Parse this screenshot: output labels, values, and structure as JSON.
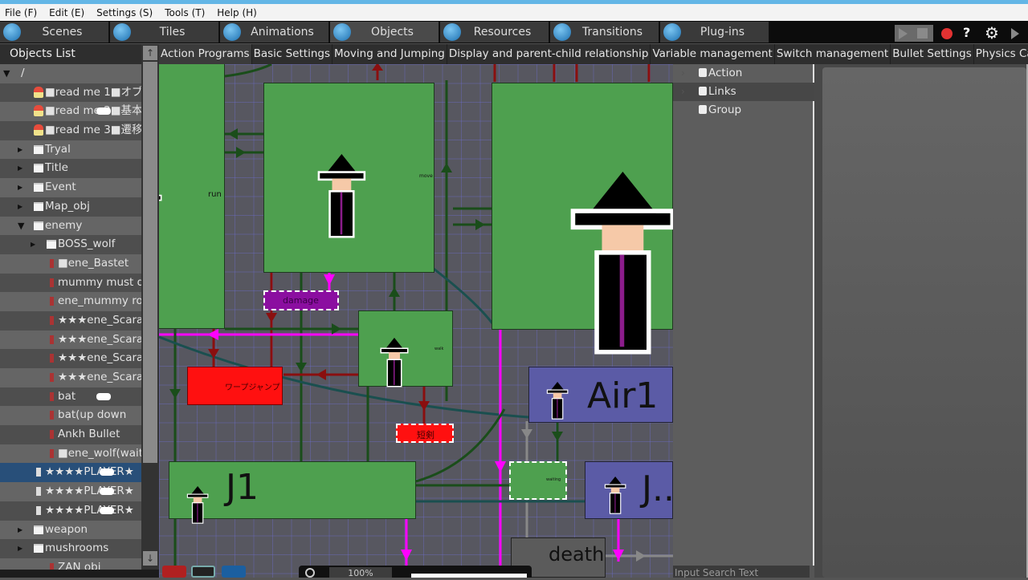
{
  "menu": [
    "File (F)",
    "Edit (E)",
    "Settings (S)",
    "Tools (T)",
    "Help (H)"
  ],
  "main_tabs": [
    {
      "label": "Scenes",
      "icon": "scenes-icon"
    },
    {
      "label": "Tiles",
      "icon": "tiles-icon"
    },
    {
      "label": "Animations",
      "icon": "animations-icon"
    },
    {
      "label": "Objects",
      "icon": "objects-icon",
      "active": true
    },
    {
      "label": "Resources",
      "icon": "resources-icon"
    },
    {
      "label": "Transitions",
      "icon": "transitions-icon"
    },
    {
      "label": "Plug-ins",
      "icon": "plugins-icon"
    }
  ],
  "toolbar_right": {
    "play": "play-icon",
    "stop": "stop-icon",
    "record": "record-icon",
    "help": "?",
    "settings": "gear-icon",
    "more": "play-small-icon"
  },
  "objects_list": {
    "title": "Objects List",
    "items": [
      {
        "label": "/",
        "type": "root",
        "expanded": true
      },
      {
        "label": "■read me 1■オブ",
        "type": "note"
      },
      {
        "label": "■read me 2■基本",
        "type": "note",
        "gamepad": true
      },
      {
        "label": "■read me 3■遷移",
        "type": "note"
      },
      {
        "label": "Tryal",
        "type": "folder"
      },
      {
        "label": "Title",
        "type": "folder"
      },
      {
        "label": "Event",
        "type": "folder"
      },
      {
        "label": "Map_obj",
        "type": "folder"
      },
      {
        "label": "enemy",
        "type": "folder",
        "expanded": true
      },
      {
        "label": "BOSS_wolf",
        "type": "folder"
      },
      {
        "label": "■ene_Bastet",
        "type": "object"
      },
      {
        "label": "mummy must die",
        "type": "object"
      },
      {
        "label": "ene_mummy rou",
        "type": "object"
      },
      {
        "label": "★★★ene_Scara",
        "type": "object"
      },
      {
        "label": "★★★ene_Scara",
        "type": "object"
      },
      {
        "label": "★★★ene_Scara",
        "type": "object"
      },
      {
        "label": "★★★ene_Scara",
        "type": "object"
      },
      {
        "label": "bat",
        "type": "object",
        "gamepad": true
      },
      {
        "label": "bat(up down",
        "type": "object"
      },
      {
        "label": "Ankh Bullet",
        "type": "object"
      },
      {
        "label": "■ene_wolf(wait",
        "type": "object"
      },
      {
        "label": "★★★★PLAYER★",
        "type": "player",
        "gamepad": true,
        "selected": true
      },
      {
        "label": "★★★★PLAYER★",
        "type": "player",
        "gamepad": true
      },
      {
        "label": "★★★★PLAYER★",
        "type": "player",
        "gamepad": true
      },
      {
        "label": "weapon",
        "type": "folder"
      },
      {
        "label": "mushrooms",
        "type": "folder"
      },
      {
        "label": "ZAN obj",
        "type": "object"
      }
    ]
  },
  "sub_tabs": [
    "Action Programs",
    "Basic Settings",
    "Moving and Jumping",
    "Display and parent-child relationship",
    "Variable management",
    "Switch management",
    "Bullet Settings",
    "Physics Ca"
  ],
  "canvas": {
    "nodes": {
      "run": "run",
      "move": "move",
      "damage": "damage",
      "loop_jump": "ワープジャンプ",
      "small_action": "walk",
      "red_small": "短剣",
      "air1": "Air1",
      "j1": "J1",
      "j2": "J..",
      "waiting": "waiting",
      "death": "death"
    },
    "zoom": "100%"
  },
  "right_panel": {
    "items": [
      {
        "label": "Action"
      },
      {
        "label": "Links",
        "highlighted": true
      },
      {
        "label": "Group"
      }
    ],
    "search_placeholder": "Input Search Text"
  }
}
